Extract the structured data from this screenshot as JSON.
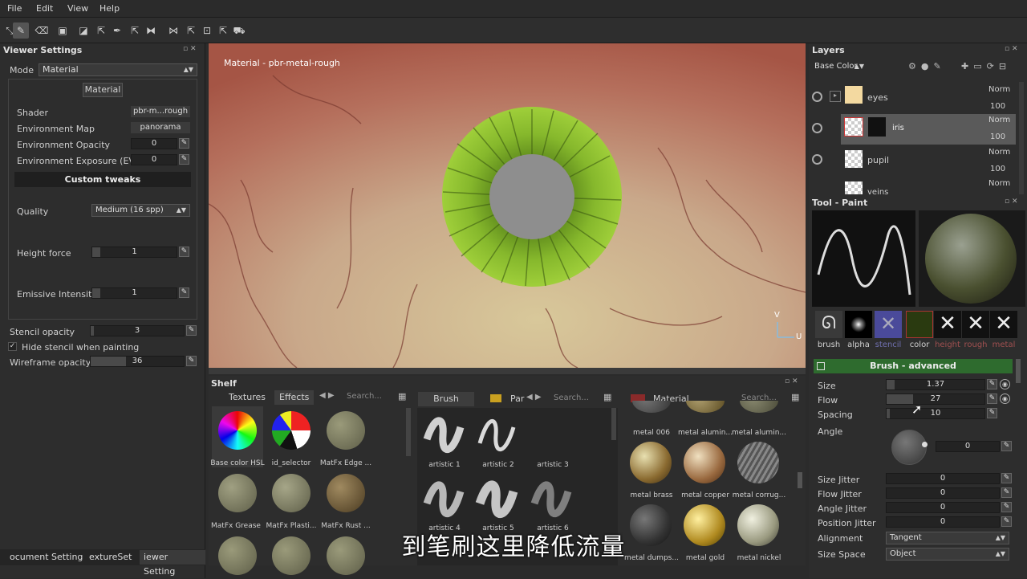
{
  "menu": [
    "File",
    "Edit",
    "View",
    "Help"
  ],
  "viewer": {
    "title": "Viewer Settings",
    "mode_label": "Mode",
    "mode_value": "Material",
    "material_button": "Material",
    "shader_label": "Shader",
    "shader_value": "pbr-m...rough",
    "envmap_label": "Environment Map",
    "envmap_value": "panorama",
    "envop_label": "Environment Opacity",
    "envop_value": "0",
    "envexp_label": "Environment Exposure (EV)",
    "envexp_value": "0",
    "custom_tweaks": "Custom tweaks",
    "quality_label": "Quality",
    "quality_value": "Medium (16 spp)",
    "height_label": "Height force",
    "height_value": "1",
    "emissive_label": "Emissive Intensity",
    "emissive_value": "1",
    "stencil_label": "Stencil opacity",
    "stencil_value": "3",
    "hide_stencil": "Hide stencil when painting",
    "wire_label": "Wireframe opacity",
    "wire_value": "36"
  },
  "bottom_tabs": [
    "ocument Setting",
    "extureSet",
    "iewer Setting"
  ],
  "viewport": {
    "label": "Material - pbr-metal-rough",
    "axis_v": "V",
    "axis_u": "U"
  },
  "shelf": {
    "title": "Shelf",
    "tabs_left": [
      "Textures",
      "Effects"
    ],
    "search": "Search...",
    "brush_tab": "Brush",
    "par_tab": "Par",
    "material_tab": "Material",
    "textures": [
      "Base color HSL",
      "id_selector",
      "MatFx Edge ...",
      "MatFx Grease",
      "MatFx Plasti...",
      "MatFx Rust ..."
    ],
    "brushes": [
      "artistic 1",
      "artistic 2",
      "artistic 3",
      "artistic 4",
      "artistic 5",
      "artistic 6"
    ],
    "materials": [
      "metal 006",
      "metal alumin...",
      "metal alumin...",
      "metal brass",
      "metal copper",
      "metal corrug...",
      "metal dumps...",
      "metal gold",
      "metal nickel"
    ]
  },
  "layers": {
    "title": "Layers",
    "channel": "Base Color",
    "items": [
      {
        "name": "eyes",
        "blend": "Norm",
        "opacity": "100"
      },
      {
        "name": "iris",
        "blend": "Norm",
        "opacity": "100"
      },
      {
        "name": "pupil",
        "blend": "Norm",
        "opacity": "100"
      },
      {
        "name": "veins",
        "blend": "Norm",
        "opacity": ""
      }
    ]
  },
  "tool": {
    "title": "Tool - Paint",
    "slots": [
      "brush",
      "alpha",
      "stencil",
      "color",
      "height",
      "rough",
      "metal"
    ],
    "section": "Brush - advanced",
    "size_label": "Size",
    "size_value": "1.37",
    "flow_label": "Flow",
    "flow_value": "27",
    "spacing_label": "Spacing",
    "spacing_value": "10",
    "angle_label": "Angle",
    "angle_value": "0",
    "size_jitter_label": "Size Jitter",
    "size_jitter_value": "0",
    "flow_jitter_label": "Flow Jitter",
    "flow_jitter_value": "0",
    "angle_jitter_label": "Angle Jitter",
    "angle_jitter_value": "0",
    "pos_jitter_label": "Position Jitter",
    "pos_jitter_value": "0",
    "alignment_label": "Alignment",
    "alignment_value": "Tangent",
    "sizespace_label": "Size Space",
    "sizespace_value": "Object"
  },
  "subtitle": "到笔刷这里降低流量",
  "colors": {
    "accent_green": "#2e6b2e",
    "iris_green": "#8cc63f"
  }
}
